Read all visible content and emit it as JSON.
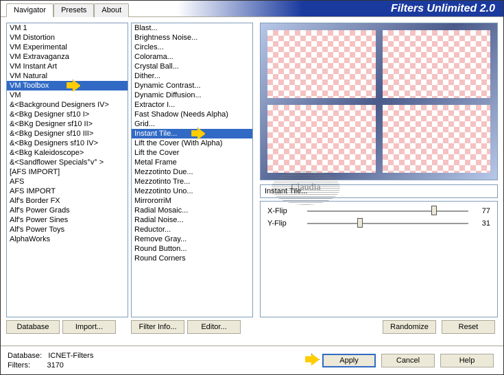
{
  "title": "Filters Unlimited 2.0",
  "tabs": {
    "navigator": "Navigator",
    "presets": "Presets",
    "about": "About"
  },
  "categories": [
    "VM 1",
    "VM Distortion",
    "VM Experimental",
    "VM Extravaganza",
    "VM Instant Art",
    "VM Natural",
    "VM Toolbox",
    "VM",
    "&<Background Designers IV>",
    "&<Bkg Designer sf10 I>",
    "&<BKg Designer sf10 II>",
    "&<Bkg Designer sf10 III>",
    "&<Bkg Designers sf10 IV>",
    "&<Bkg Kaleidoscope>",
    "&<Sandflower Specials°v° >",
    "[AFS IMPORT]",
    "AFS",
    "AFS IMPORT",
    "Alf's Border FX",
    "Alf's Power Grads",
    "Alf's Power Sines",
    "Alf's Power Toys",
    "AlphaWorks"
  ],
  "selectedCategoryIndex": 6,
  "filters": [
    "Blast...",
    "Brightness Noise...",
    "Circles...",
    "Colorama...",
    "Crystal Ball...",
    "Dither...",
    "Dynamic Contrast...",
    "Dynamic Diffusion...",
    "Extractor I...",
    "Fast Shadow (Needs Alpha)",
    "Grid...",
    "Instant Tile...",
    "Lift the Cover (With Alpha)",
    "Lift the Cover",
    "Metal Frame",
    "Mezzotinto Due...",
    "Mezzotinto Tre...",
    "Mezzotinto Uno...",
    "MirrororriM",
    "Radial Mosaic...",
    "Radial Noise...",
    "Reductor...",
    "Remove Gray...",
    "Round Button...",
    "Round Corners"
  ],
  "selectedFilterIndex": 11,
  "currentFilterName": "Instant Tile...",
  "sliders": [
    {
      "label": "X-Flip",
      "value": 77
    },
    {
      "label": "Y-Flip",
      "value": 31
    }
  ],
  "buttons": {
    "database": "Database",
    "import": "Import...",
    "filterInfo": "Filter Info...",
    "editor": "Editor...",
    "randomize": "Randomize",
    "reset": "Reset",
    "apply": "Apply",
    "cancel": "Cancel",
    "help": "Help"
  },
  "footer": {
    "dbLabel": "Database:",
    "dbValue": "ICNET-Filters",
    "filtersLabel": "Filters:",
    "filtersValue": "3170"
  },
  "watermark": "Claudia"
}
